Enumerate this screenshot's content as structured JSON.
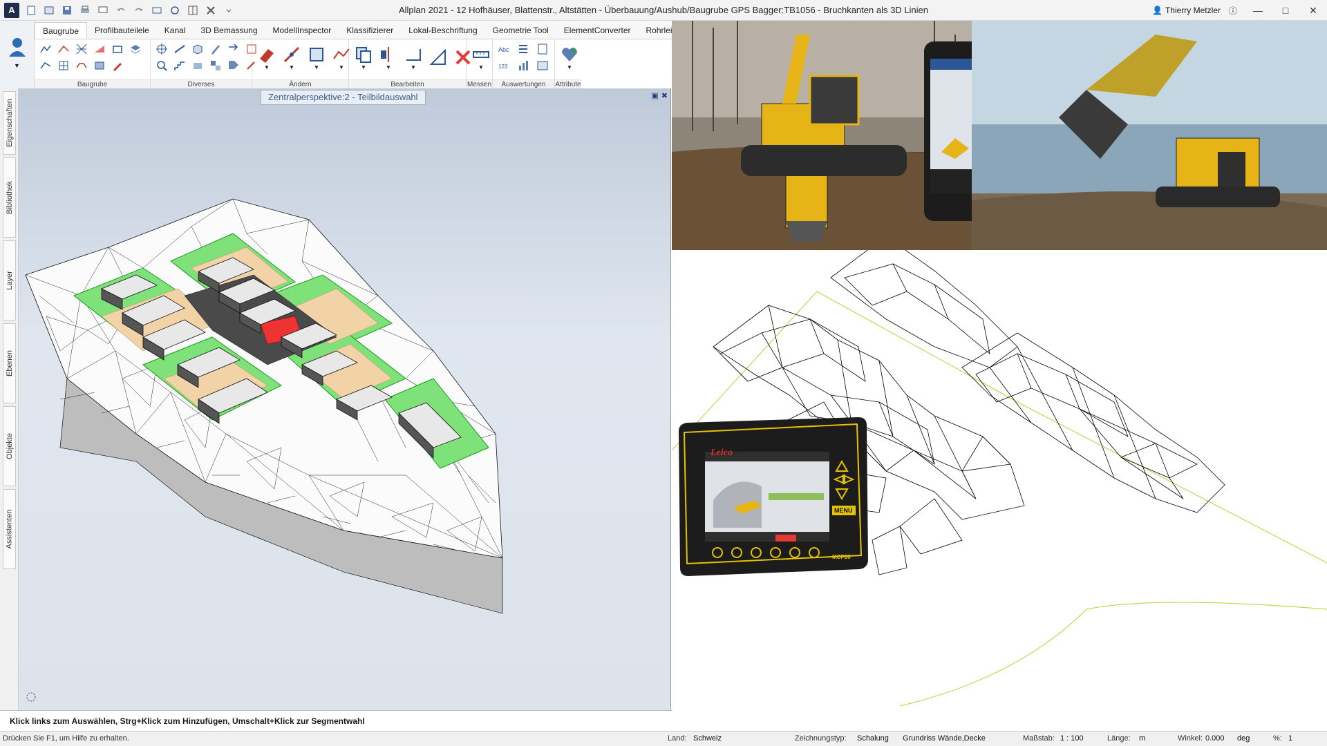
{
  "window": {
    "title": "Allplan 2021 - 12 Hofhäuser, Blattenstr., Altstätten - Überbauung/Aushub/Baugrube GPS Bagger:TB1056 - Bruchkanten als 3D Linien",
    "user": "Thierry Metzler",
    "logo": "A"
  },
  "ribbon": {
    "tabs": [
      "Baugrube",
      "Profilbauteilele",
      "Kanal",
      "3D Bemassung",
      "ModellInspector",
      "Klassifizierer",
      "Lokal-Beschriftung",
      "Geometrie Tool",
      "ElementConverter",
      "Rohrleitun"
    ],
    "active_tab": "Baugrube",
    "groups": [
      "Baugrube",
      "Diverses",
      "Ändern",
      "Bearbeiten",
      "Messen",
      "Auswertungen",
      "Attribute"
    ]
  },
  "side_tabs": [
    "Eigenschaften",
    "Bibliothek",
    "Layer",
    "Ebenen",
    "Objekte",
    "Assistenten"
  ],
  "viewport": {
    "title": "Zentralperspektive:2 - Teilbildauswahl"
  },
  "prompt": "Klick links zum Auswählen, Strg+Klick zum Hinzufügen, Umschalt+Klick zur Segmentwahl",
  "status": {
    "help": "Drücken Sie F1, um Hilfe zu erhalten.",
    "land_label": "Land:",
    "land_value": "Schweiz",
    "zeichnungstyp_label": "Zeichnungstyp:",
    "zeichnungstyp_value": "Schalung",
    "grundriss": "Grundriss Wände,Decke",
    "massstab_label": "Maßstab:",
    "massstab_value": "1 : 100",
    "laenge_label": "Länge:",
    "laenge_value": "m",
    "winkel_label": "Winkel:",
    "winkel_value": "0.000",
    "winkel_unit": "deg",
    "prozent_label": "%:",
    "prozent_value": "1"
  },
  "devices": {
    "leica_brand": "Leica",
    "menu_label": "MENU",
    "mcp_label": "MCP80"
  },
  "colors": {
    "accent": "#2b5797",
    "terrain_green": "#6fe36f",
    "excavator_yellow": "#e6b417",
    "boundary_line": "#c8c832"
  }
}
